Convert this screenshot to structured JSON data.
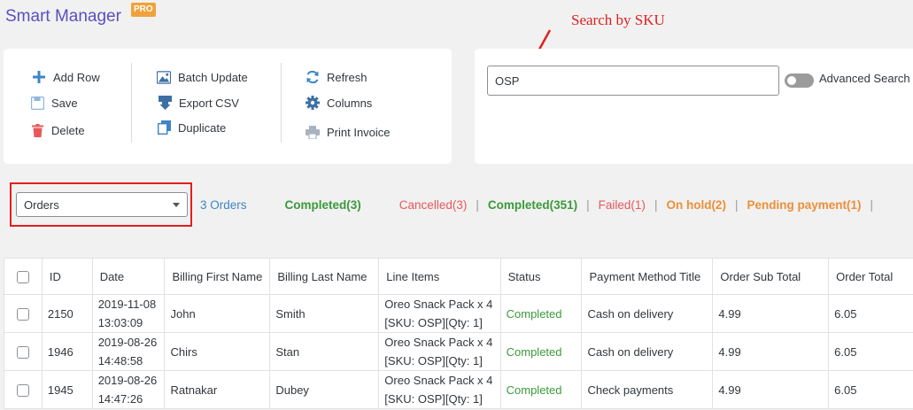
{
  "app": {
    "title": "Smart Manager",
    "badge": "PRO"
  },
  "annotation": {
    "text": "Search by SKU"
  },
  "toolbar": {
    "add_row": "Add Row",
    "save": "Save",
    "delete": "Delete",
    "batch_update": "Batch Update",
    "export_csv": "Export CSV",
    "duplicate": "Duplicate",
    "refresh": "Refresh",
    "columns": "Columns",
    "print_invoice": "Print Invoice"
  },
  "search": {
    "value": "OSP",
    "advanced_label": "Advanced Search",
    "advanced_enabled": false
  },
  "filter": {
    "selected": "Orders",
    "count_label": "3 Orders"
  },
  "stats": [
    {
      "label": "Completed(3)",
      "color": "green"
    },
    {
      "label": "Cancelled(3)",
      "color": "red"
    },
    {
      "label": "Completed(351)",
      "color": "green"
    },
    {
      "label": "Failed(1)",
      "color": "red"
    },
    {
      "label": "On hold(2)",
      "color": "orange"
    },
    {
      "label": "Pending payment(1)",
      "color": "orange"
    }
  ],
  "table": {
    "headers": [
      "ID",
      "Date",
      "Billing First Name",
      "Billing Last Name",
      "Line Items",
      "Status",
      "Payment Method Title",
      "Order Sub Total",
      "Order Total"
    ],
    "rows": [
      {
        "id": "2150",
        "date1": "2019-11-08",
        "date2": "13:03:09",
        "first": "John",
        "last": "Smith",
        "item1": "Oreo Snack Pack x 4",
        "item2": "[SKU: OSP][Qty: 1]",
        "status": "Completed",
        "payment": "Cash on delivery",
        "subtotal": "4.99",
        "total": "6.05"
      },
      {
        "id": "1946",
        "date1": "2019-08-26",
        "date2": "14:48:58",
        "first": "Chirs",
        "last": "Stan",
        "item1": "Oreo Snack Pack x 4",
        "item2": "[SKU: OSP][Qty: 1]",
        "status": "Completed",
        "payment": "Cash on delivery",
        "subtotal": "4.99",
        "total": "6.05"
      },
      {
        "id": "1945",
        "date1": "2019-08-26",
        "date2": "14:47:26",
        "first": "Ratnakar",
        "last": "Dubey",
        "item1": "Oreo Snack Pack x 4",
        "item2": "[SKU: OSP][Qty: 1]",
        "status": "Completed",
        "payment": "Check payments",
        "subtotal": "4.99",
        "total": "6.05"
      }
    ]
  }
}
